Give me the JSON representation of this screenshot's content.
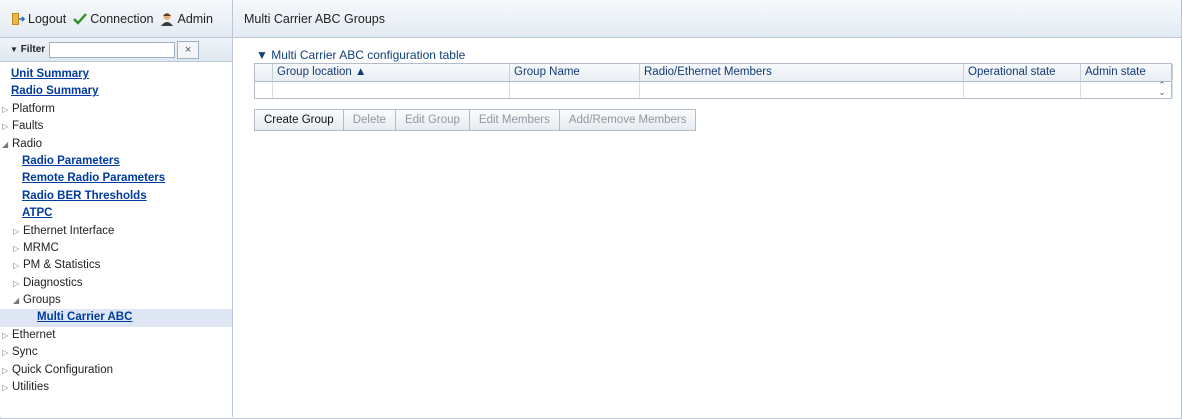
{
  "topbar": {
    "logout": "Logout",
    "connection": "Connection",
    "admin": "Admin",
    "colors": {
      "logout": "#c78a1a",
      "connection": "#2f8f1f",
      "admin": "#4a4a4a"
    }
  },
  "filter": {
    "label": "Filter",
    "value": "",
    "placeholder": "",
    "clear": "×"
  },
  "nav": [
    {
      "label": "Unit Summary",
      "level": 0,
      "type": "link"
    },
    {
      "label": "Radio Summary",
      "level": 0,
      "type": "link"
    },
    {
      "label": "Platform",
      "level": 0,
      "type": "collapsed"
    },
    {
      "label": "Faults",
      "level": 0,
      "type": "collapsed"
    },
    {
      "label": "Radio",
      "level": 0,
      "type": "expanded"
    },
    {
      "label": "Radio Parameters",
      "level": 1,
      "type": "link"
    },
    {
      "label": "Remote Radio Parameters",
      "level": 1,
      "type": "link"
    },
    {
      "label": "Radio BER Thresholds",
      "level": 1,
      "type": "link"
    },
    {
      "label": "ATPC",
      "level": 1,
      "type": "link"
    },
    {
      "label": "Ethernet Interface",
      "level": 1,
      "type": "collapsed"
    },
    {
      "label": "MRMC",
      "level": 1,
      "type": "collapsed"
    },
    {
      "label": "PM & Statistics",
      "level": 1,
      "type": "collapsed"
    },
    {
      "label": "Diagnostics",
      "level": 1,
      "type": "collapsed"
    },
    {
      "label": "Groups",
      "level": 1,
      "type": "expanded"
    },
    {
      "label": "Multi Carrier ABC",
      "level": 2,
      "type": "link",
      "selected": true
    },
    {
      "label": "Ethernet",
      "level": 0,
      "type": "collapsed"
    },
    {
      "label": "Sync",
      "level": 0,
      "type": "collapsed"
    },
    {
      "label": "Quick Configuration",
      "level": 0,
      "type": "collapsed"
    },
    {
      "label": "Utilities",
      "level": 0,
      "type": "collapsed"
    }
  ],
  "main": {
    "page_title": "Multi Carrier ABC Groups",
    "section_title": "▼ Multi Carrier ABC configuration table",
    "table": {
      "columns": [
        "",
        "Group location ▲",
        "Group Name",
        "Radio/Ethernet Members",
        "Operational state",
        "Admin state"
      ],
      "rows": [
        [
          "",
          "",
          "",
          "",
          "",
          ""
        ]
      ]
    },
    "buttons": [
      {
        "label": "Create Group",
        "enabled": true
      },
      {
        "label": "Delete",
        "enabled": false
      },
      {
        "label": "Edit Group",
        "enabled": false
      },
      {
        "label": "Edit Members",
        "enabled": false
      },
      {
        "label": "Add/Remove Members",
        "enabled": false
      }
    ]
  }
}
